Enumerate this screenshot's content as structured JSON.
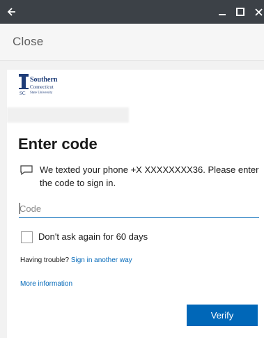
{
  "titlebar": {
    "back_icon": "back-arrow-icon",
    "minimize_icon": "minimize-icon",
    "maximize_icon": "maximize-icon",
    "close_icon": "close-icon",
    "background": "#3c4147"
  },
  "close_bar": {
    "label": "Close"
  },
  "logo": {
    "line1": "Southern",
    "line2": "Connecticut",
    "line3": "State University",
    "color": "#1f3d78"
  },
  "main": {
    "title": "Enter code",
    "message_icon": "message-icon",
    "message": "We texted your phone +X XXXXXXXX36. Please enter the code to sign in.",
    "code_input": {
      "placeholder": "Code",
      "value": ""
    },
    "remember": {
      "label": "Don't ask again for 60 days",
      "checked": false
    },
    "trouble_text": "Having trouble?",
    "trouble_link": "Sign in another way",
    "more_info": "More information",
    "verify_label": "Verify",
    "accent": "#0067b8"
  }
}
